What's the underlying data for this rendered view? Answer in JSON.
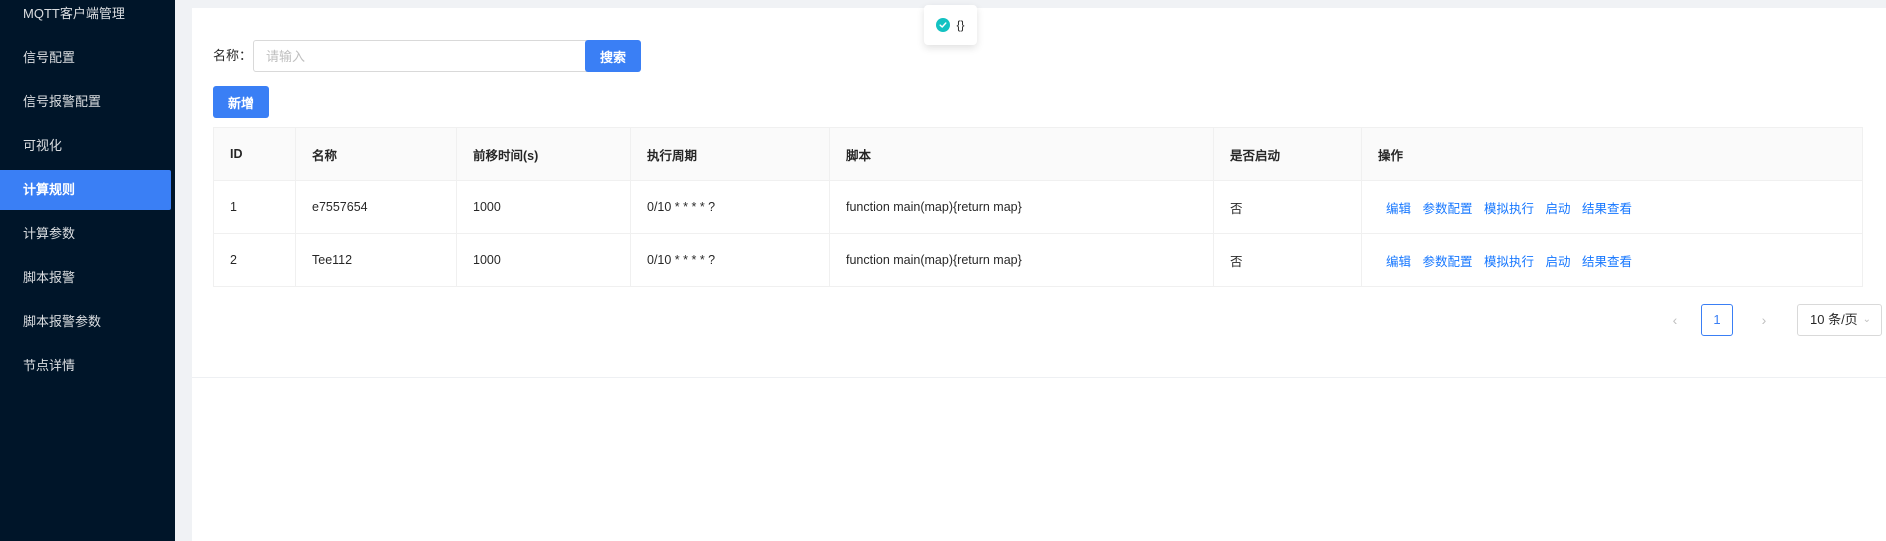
{
  "sidebar": {
    "items": [
      {
        "label": "MQTT客户端管理"
      },
      {
        "label": "信号配置"
      },
      {
        "label": "信号报警配置"
      },
      {
        "label": "可视化"
      },
      {
        "label": "计算规则"
      },
      {
        "label": "计算参数"
      },
      {
        "label": "脚本报警"
      },
      {
        "label": "脚本报警参数"
      },
      {
        "label": "节点详情"
      }
    ],
    "active_index": 4
  },
  "toast": {
    "message": "{}"
  },
  "search": {
    "label": "名称：",
    "placeholder": "请输入",
    "value": "",
    "button_label": "搜索"
  },
  "toolbar": {
    "add_label": "新增"
  },
  "table": {
    "columns": [
      "ID",
      "名称",
      "前移时间(s)",
      "执行周期",
      "脚本",
      "是否启动",
      "操作"
    ],
    "rows": [
      {
        "id": "1",
        "name": "e7557654",
        "shift": "1000",
        "cycle": "0/10 * * * * ?",
        "script": "function main(map){return map}",
        "enabled": "否"
      },
      {
        "id": "2",
        "name": "Tee112",
        "shift": "1000",
        "cycle": "0/10 * * * * ?",
        "script": "function main(map){return map}",
        "enabled": "否"
      }
    ],
    "actions": [
      "编辑",
      "参数配置",
      "模拟执行",
      "启动",
      "结果查看"
    ]
  },
  "pagination": {
    "current_page": "1",
    "page_size": "10 条/页"
  },
  "colors": {
    "sidebar_bg": "#001529",
    "primary": "#3a7ff5",
    "link": "#1677ff",
    "success": "#13c2c2"
  }
}
